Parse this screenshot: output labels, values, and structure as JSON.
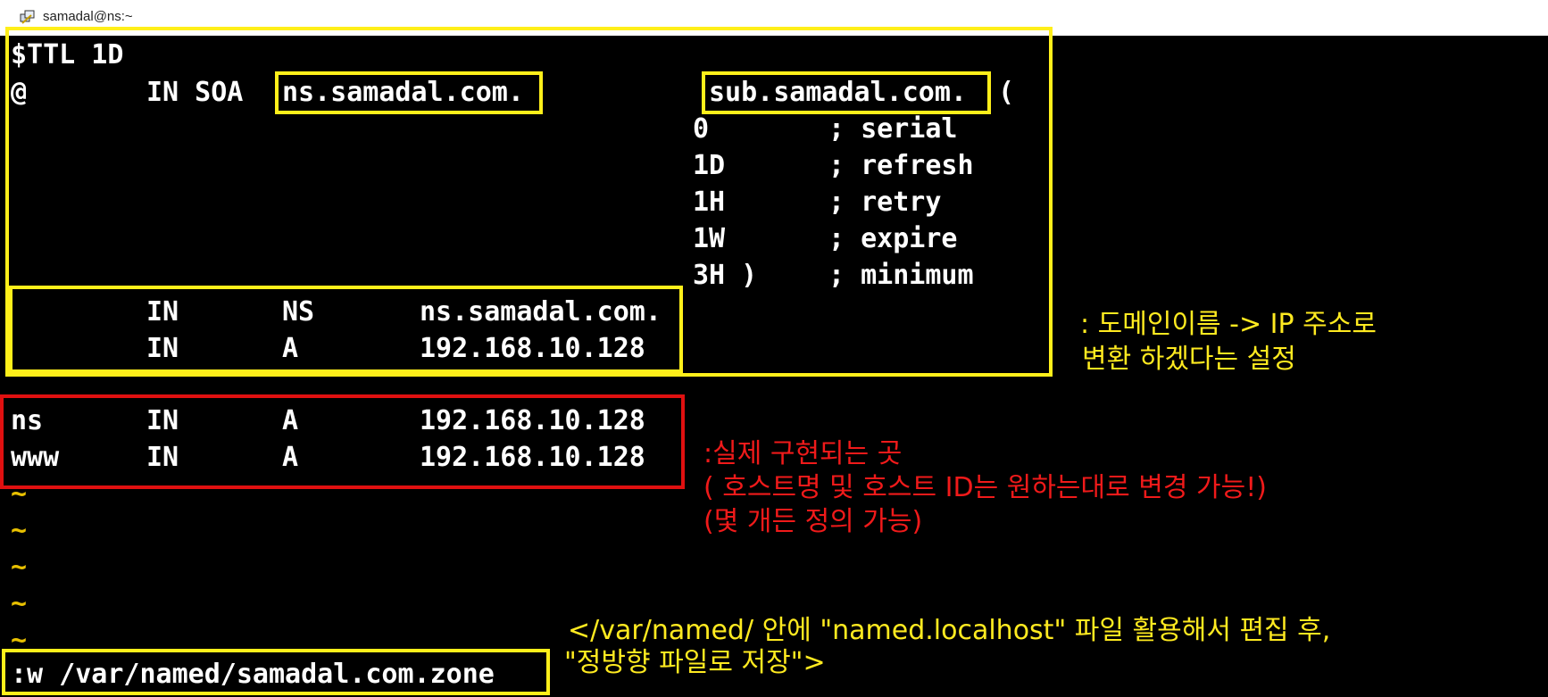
{
  "window": {
    "title": "samadal@ns:~",
    "icon": "putty-icon"
  },
  "zone": {
    "ttl_line": "$TTL 1D",
    "soa": {
      "at": "@",
      "class_type": "IN SOA",
      "primary_ns": "ns.samadal.com.",
      "admin": "sub.samadal.com.",
      "paren": "("
    },
    "soa_fields": [
      {
        "value": "0",
        "comment": "; serial"
      },
      {
        "value": "1D",
        "comment": "; refresh"
      },
      {
        "value": "1H",
        "comment": "; retry"
      },
      {
        "value": "1W",
        "comment": "; expire"
      },
      {
        "value": "3H )",
        "comment": "; minimum"
      }
    ],
    "base_records": [
      {
        "class": "IN",
        "type": "NS",
        "data": "ns.samadal.com."
      },
      {
        "class": "IN",
        "type": "A",
        "data": "192.168.10.128"
      }
    ],
    "host_records": [
      {
        "name": "ns",
        "class": "IN",
        "type": "A",
        "data": "192.168.10.128"
      },
      {
        "name": "www",
        "class": "IN",
        "type": "A",
        "data": "192.168.10.128"
      }
    ],
    "tilde": "~"
  },
  "command_line": ":w /var/named/samadal.com.zone",
  "annotations": {
    "yellow_note": [
      ": 도메인이름 -> IP 주소로",
      "변환 하겠다는 설정"
    ],
    "red_note": [
      ":실제 구현되는 곳",
      "( 호스트명 및 호스트 ID는 원하는대로 변경 가능!)",
      "(몇 개든 정의 가능)"
    ],
    "bottom_note": [
      "</var/named/ 안에 \"named.localhost\" 파일 활용해서 편집 후,",
      "\"정방향 파일로 저장\">"
    ]
  },
  "colors": {
    "yellow": "#ffef1a",
    "red": "#e01010",
    "tilde": "#e8c000"
  }
}
